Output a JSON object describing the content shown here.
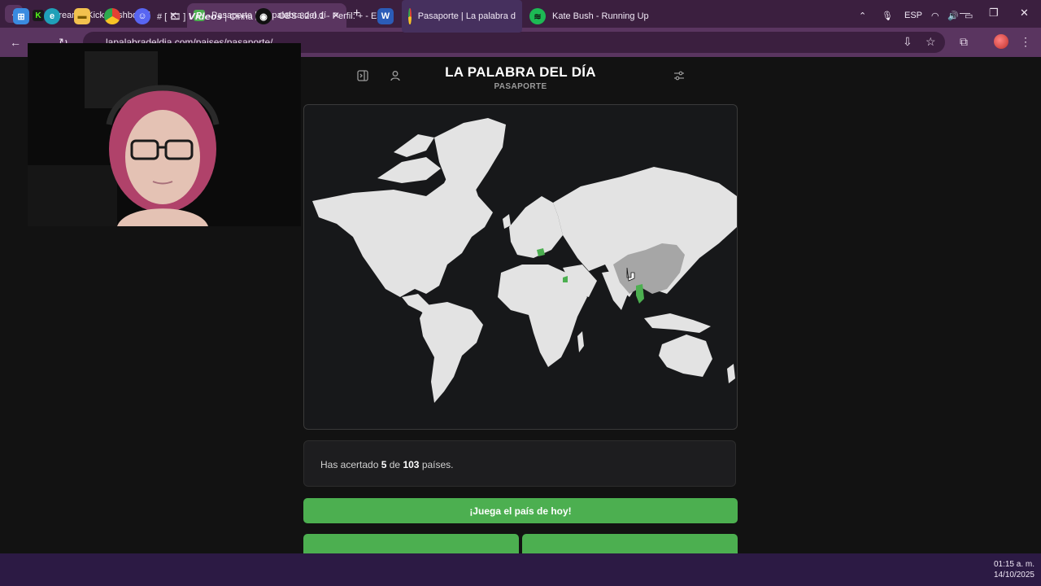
{
  "browser": {
    "tabs": [
      {
        "title": "Stream - Kick Dashboard",
        "favicon": "K",
        "active": false
      },
      {
        "title": "Pasaporte | La palabra del día",
        "favicon": "P",
        "active": true
      }
    ],
    "url": "lapalabradeldia.com/paises/pasaporte/",
    "colors": {
      "frame": "#3b1f3f",
      "toolbar": "#5a3560"
    }
  },
  "site": {
    "title": "LA PALABRA DEL DÍA",
    "subtitle": "PASAPORTE"
  },
  "score": {
    "prefix": "Has acertado",
    "correct": "5",
    "connector": "de",
    "total": "103",
    "suffix": "países."
  },
  "buttons": {
    "play_today": "¡Juega el país de hoy!"
  },
  "map": {
    "highlighted_countries": [
      "China"
    ],
    "guessed_color": "#4caf50",
    "land_color": "#e3e3e3",
    "highlight_color": "#a6a6a6",
    "background": "#17181a"
  },
  "taskbar": {
    "apps": [
      {
        "label": "# [ 🎞 ] 𝙑𝙞𝙙𝙚𝙤𝙨 | Cinna",
        "icon": "discord-icon"
      },
      {
        "label": "OBS 32.0.1 - Perfil: + - Es",
        "icon": "obs-icon"
      },
      {
        "label": "Pasaporte | La palabra d",
        "icon": "chrome-icon"
      },
      {
        "label": "Kate Bush - Running Up",
        "icon": "spotify-icon"
      }
    ],
    "language": "ESP",
    "time": "01:15 a. m.",
    "date": "14/10/2025"
  }
}
